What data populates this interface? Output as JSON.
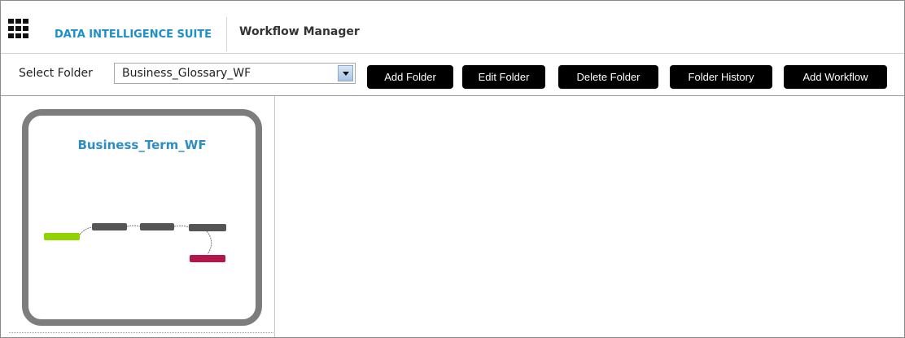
{
  "header": {
    "suite_name": "DATA INTELLIGENCE SUITE",
    "module_name": "Workflow Manager",
    "app_icon": "app-grid-icon"
  },
  "toolbar": {
    "select_label": "Select Folder",
    "selected_folder": "Business_Glossary_WF",
    "buttons": {
      "add_folder": "Add Folder",
      "edit_folder": "Edit Folder",
      "delete_folder": "Delete Folder",
      "folder_history": "Folder History",
      "add_workflow": "Add Workflow"
    }
  },
  "workflows": [
    {
      "name": "Business_Term_WF"
    }
  ],
  "colors": {
    "brand": "#1c8fc7",
    "workflow_title": "#2f8dc6",
    "button_bg": "#000000",
    "start_node": "#8fd400",
    "state_node": "#555555",
    "end_node": "#b3174a"
  }
}
